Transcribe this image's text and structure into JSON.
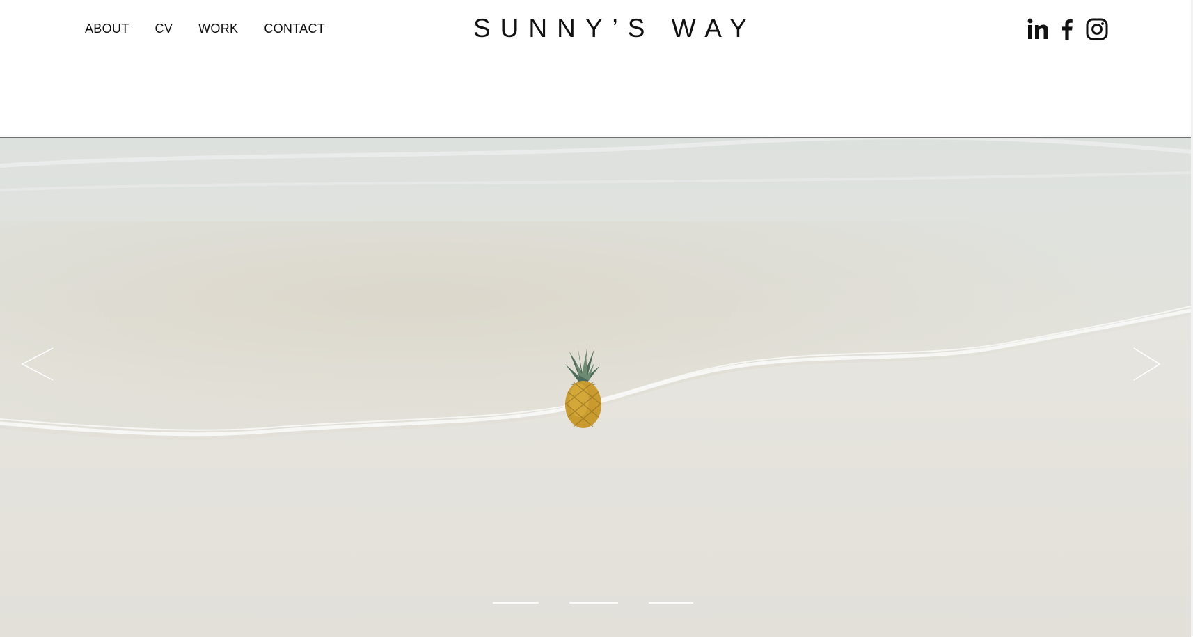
{
  "site": {
    "title": "SUNNY’S WAY"
  },
  "nav": {
    "items": [
      {
        "label": "ABOUT"
      },
      {
        "label": "CV"
      },
      {
        "label": "WORK"
      },
      {
        "label": "CONTACT"
      }
    ]
  },
  "social": [
    {
      "icon": "linkedin-icon"
    },
    {
      "icon": "facebook-icon"
    },
    {
      "icon": "instagram-icon"
    }
  ],
  "slideshow": {
    "image": "pineapple-on-beach-photo",
    "slide_count": 3,
    "prev_icon": "chevron-left-icon",
    "next_icon": "chevron-right-icon"
  },
  "colors": {
    "text": "#111111",
    "sand": "#e4e2db",
    "water": "#dfe3de",
    "divider": "#6d6d6d"
  }
}
